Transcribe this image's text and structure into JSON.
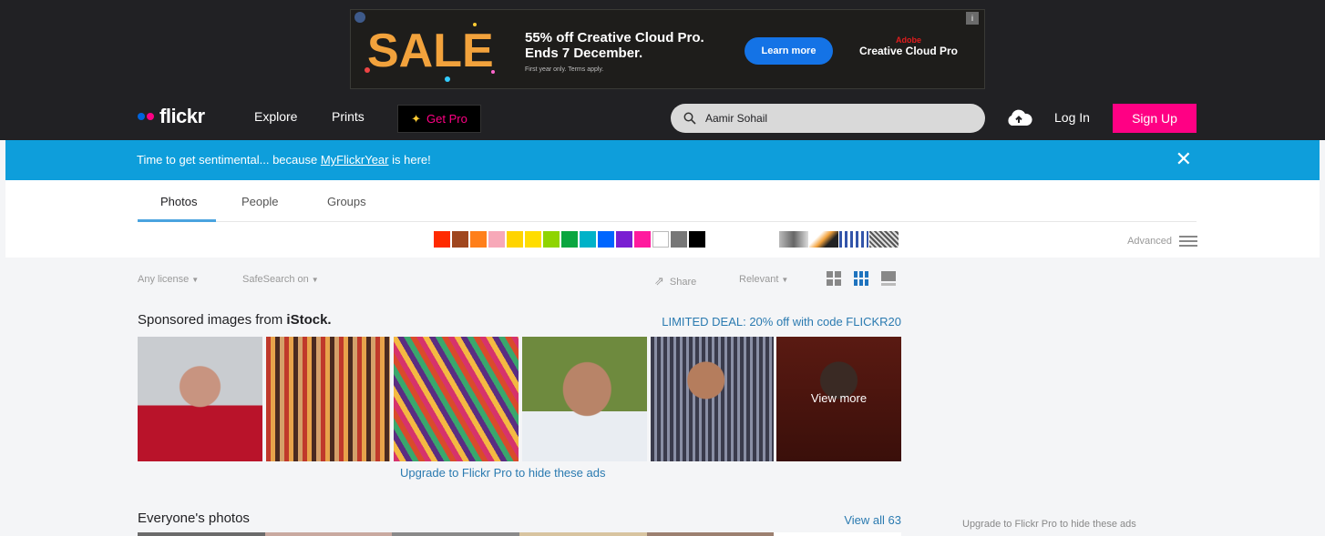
{
  "ad": {
    "sale_text": "SALE",
    "headline_line1": "55% off Creative Cloud Pro.",
    "headline_line2": "Ends 7 December.",
    "fine_print": "First year only. Terms apply.",
    "cta_label": "Learn more",
    "brand": "Adobe",
    "product": "Creative Cloud Pro",
    "accent_color": "#1473e6"
  },
  "nav": {
    "logo_text": "flickr",
    "logo_dot_colors": [
      "#0063dc",
      "#ff0084"
    ],
    "links": [
      "Explore",
      "Prints"
    ],
    "get_pro_label": "Get Pro",
    "search_value": "Aamir Sohail",
    "login_label": "Log In",
    "signup_label": "Sign Up",
    "signup_color": "#ff0084"
  },
  "banner": {
    "message_prefix": "Time to get sentimental... because ",
    "link_text": "MyFlickrYear",
    "message_suffix": " is here!",
    "close_glyph": "✕",
    "color": "#0e9edb"
  },
  "tabs": [
    {
      "label": "Photos",
      "active": true
    },
    {
      "label": "People",
      "active": false
    },
    {
      "label": "Groups",
      "active": false
    }
  ],
  "color_swatches": [
    "#ff2a00",
    "#a0461e",
    "#ff7f1a",
    "#f7a8b8",
    "#ffd400",
    "#ffdd00",
    "#8fd400",
    "#0aa640",
    "#00b2c8",
    "#0066ff",
    "#7a1fd2",
    "#ff1a9e",
    "#ffffff",
    "#777777",
    "#000000"
  ],
  "advanced_label": "Advanced",
  "toolbar": {
    "license": "Any license",
    "safesearch": "SafeSearch on",
    "share": "Share",
    "sort": "Relevant"
  },
  "sponsored": {
    "title_prefix": "Sponsored images from",
    "brand": "iStock.",
    "deal": "LIMITED DEAL: 20% off with code FLICKR20",
    "view_more": "View more",
    "upgrade_text": "Upgrade to Flickr Pro to hide these ads"
  },
  "everyone": {
    "title": "Everyone's photos",
    "view_all": "View all 63"
  },
  "side_upgrade": "Upgrade to Flickr Pro to hide these ads"
}
